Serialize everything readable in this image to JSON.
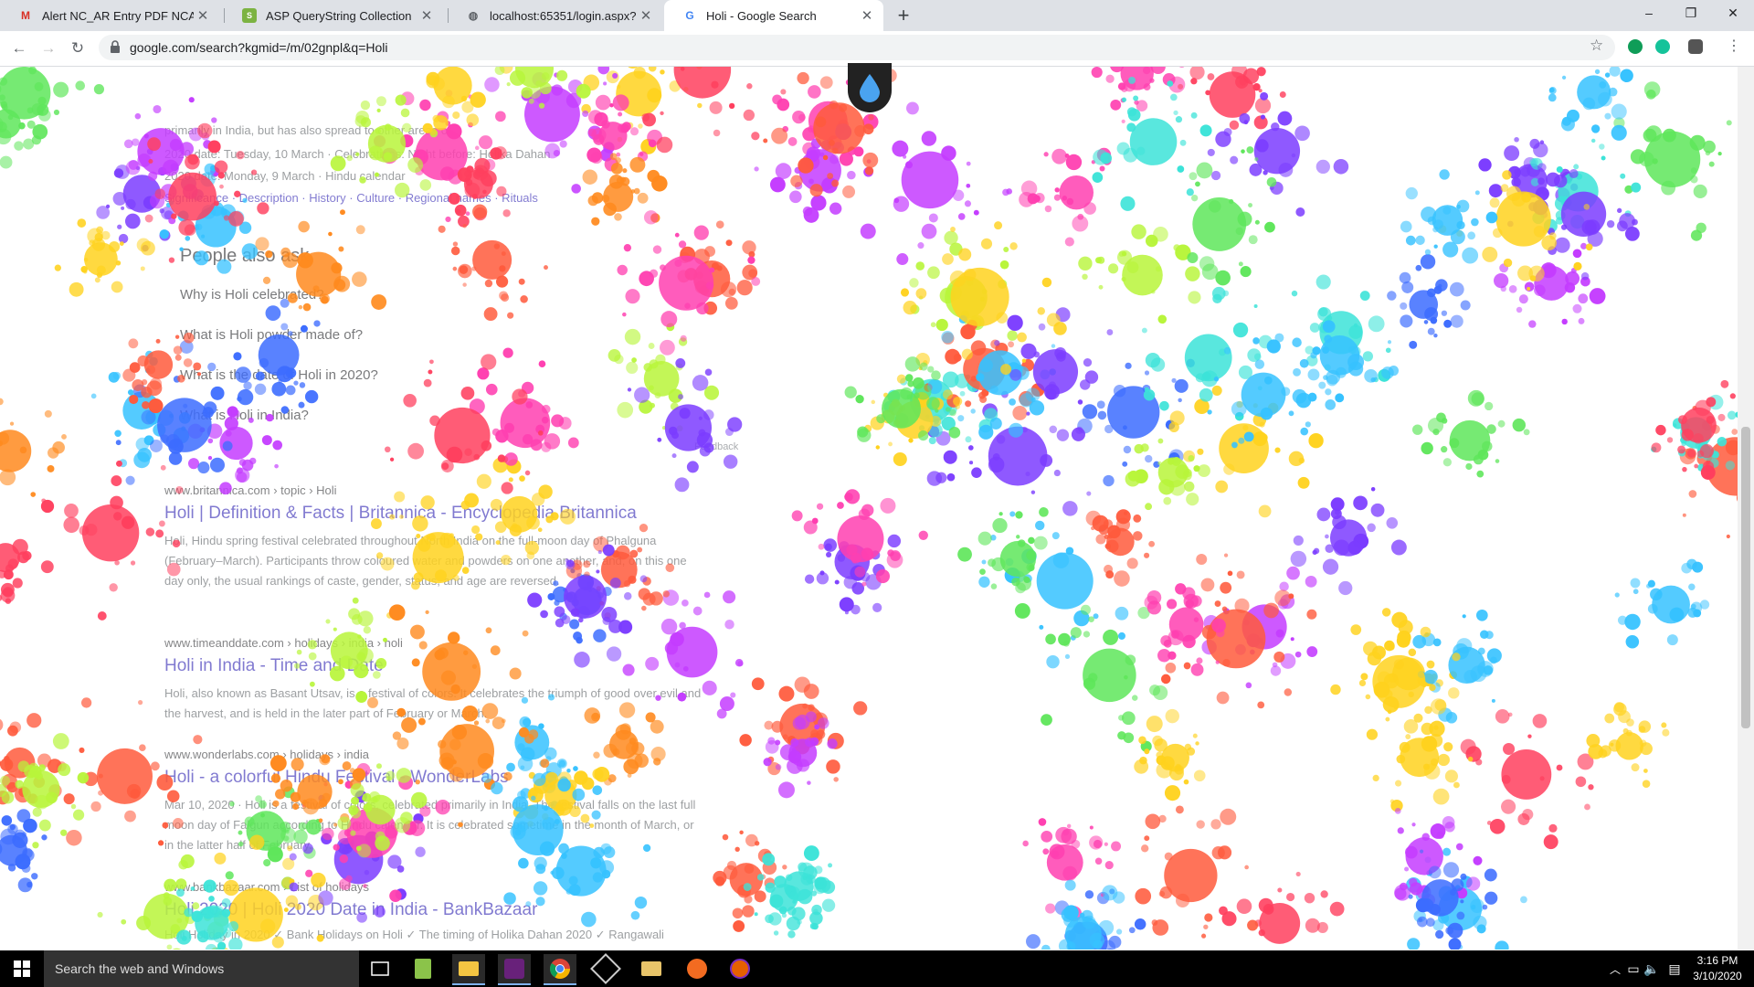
{
  "tabs": [
    {
      "label": "Alert NC_AR Entry PDF NCAR_File",
      "icon": "gmail-icon"
    },
    {
      "label": "ASP QueryString Collection",
      "icon": "site-favicon"
    },
    {
      "label": "localhost:65351/login.aspx?Userna",
      "icon": "globe-icon"
    },
    {
      "label": "Holi - Google Search",
      "icon": "google-g-icon"
    }
  ],
  "address_bar": {
    "url": "google.com/search?kgmid=/m/02gnpl&q=Holi"
  },
  "window_controls": {
    "minimize": "–",
    "maximize": "❐",
    "close": "✕"
  },
  "page": {
    "lines": [
      "primarily in India, but has also spread to other areas of",
      "2020 date: Tuesday, 10 March · Celebrations: Night before: Holika Dahan",
      "2020 date: Monday, 9 March · Hindu calendar",
      "Significance · Description · History · Culture · Regional names · Rituals"
    ],
    "people_also_ask": {
      "heading": "People also ask",
      "questions": [
        "Why is Holi celebrated?",
        "What is Holi powder made of?",
        "What is the date of Holi in 2020?",
        "What is Holi in India?"
      ],
      "feedback": "Feedback"
    },
    "results": [
      {
        "cite": "www.britannica.com › topic › Holi",
        "title": "Holi | Definition & Facts | Britannica - Encyclopedia Britannica",
        "snippet": "Holi, Hindu spring festival celebrated throughout North India on the full-moon day of Phalguna (February–March). Participants throw coloured water and powders on one another, and, on this one day only, the usual rankings of caste, gender, status, and age are reversed."
      },
      {
        "cite": "www.timeanddate.com › holidays › india › holi",
        "title": "Holi in India - Time and Date",
        "snippet": "Holi, also known as Basant Utsav, is a festival of colors. It celebrates the triumph of good over evil and the harvest, and is held in the later part of February or March."
      },
      {
        "cite": "www.wonderlabs.com › holidays › india",
        "title": "Holi - a colorful Hindu Festival - WonderLabs",
        "snippet": "Mar 10, 2020 · Holi is a festival of colors, celebrated primarily in India. The festival falls on the last full moon day of Falgun according to Hindu calendar. It is celebrated sometime in the month of March, or in the latter half of February."
      },
      {
        "cite": "www.bankbazaar.com › List of holidays",
        "title": "Holi 2020 | Holi 2020 Date in India - BankBazaar",
        "snippet": "Holi Holiday in 2020 ✓ Bank Holidays on Holi ✓ The timing of Holika Dahan 2020 ✓ Rangawali"
      }
    ]
  },
  "taskbar": {
    "search_placeholder": "Search the web and Windows",
    "time": "3:16 PM",
    "date": "3/10/2020"
  }
}
